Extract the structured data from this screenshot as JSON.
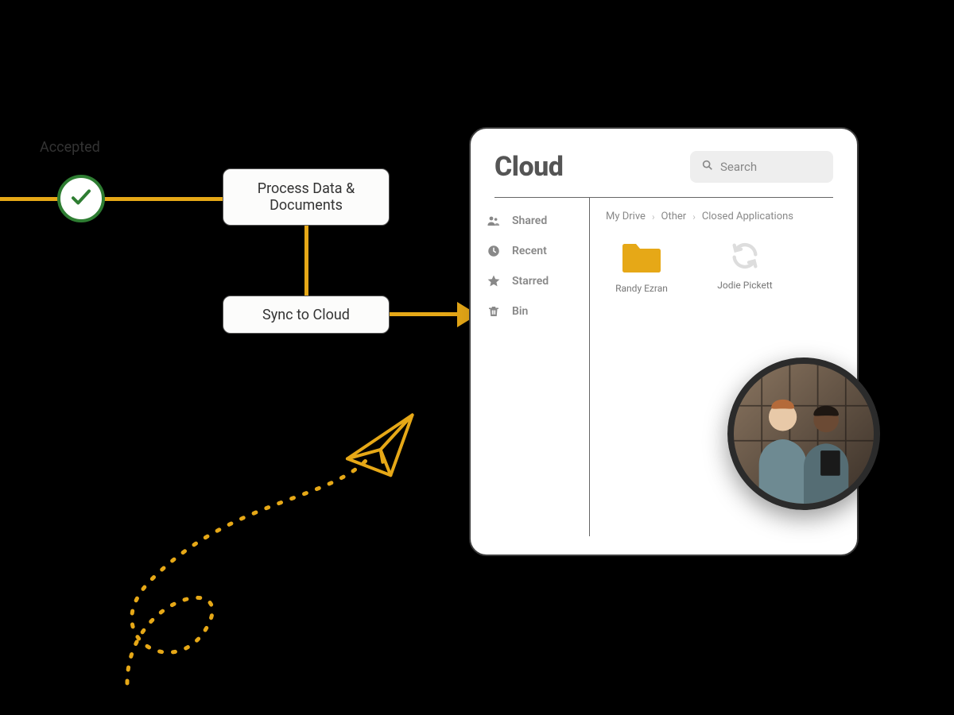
{
  "flow": {
    "accepted_label": "Accepted",
    "node1_label": "Process Data & Documents",
    "node2_label": "Sync to Cloud"
  },
  "cloud": {
    "title": "Cloud",
    "search_placeholder": "Search",
    "sidebar": {
      "shared": "Shared",
      "recent": "Recent",
      "starred": "Starred",
      "bin": "Bin"
    },
    "breadcrumb": {
      "a": "My Drive",
      "b": "Other",
      "c": "Closed Applications"
    },
    "items": {
      "folder_name": "Randy Ezran",
      "sync_name": "Jodie Pickett"
    }
  }
}
